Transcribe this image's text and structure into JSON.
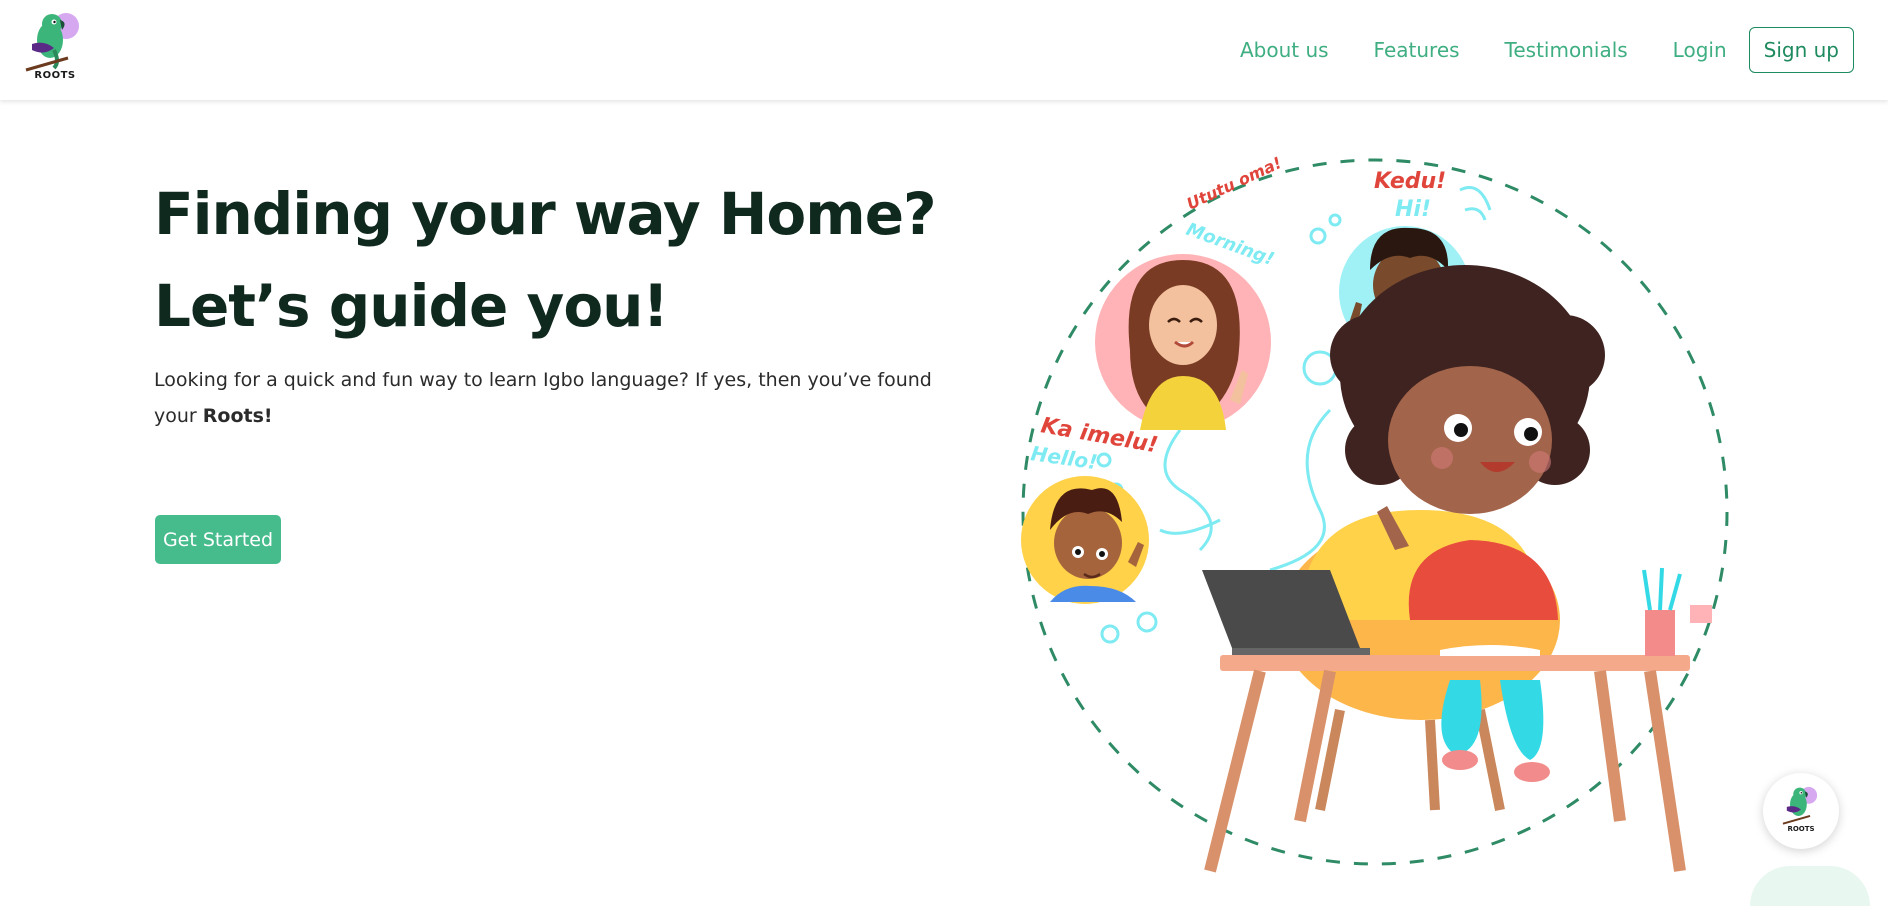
{
  "brand": {
    "name": "ROOTS"
  },
  "nav": {
    "links": [
      "About us",
      "Features",
      "Testimonials",
      "Login"
    ],
    "signup_label": "Sign up"
  },
  "hero": {
    "title_line1": "Finding your way Home?",
    "title_line2": "Let’s guide you!",
    "desc_text": "Looking for a quick and fun way to learn Igbo language? If yes, then you’ve found your",
    "desc_bold": "Roots!",
    "cta_label": "Get Started"
  },
  "illustration": {
    "greetings": [
      "Kedu!",
      "Hi!",
      "Ka imelu!",
      "Hello!",
      "Ututu oma!",
      "Morning!"
    ]
  },
  "floating_widget": {
    "label": "ROOTS"
  },
  "colors": {
    "primary": "#46bb8c",
    "primary_dark": "#1e8a5f",
    "heading": "#10291f"
  }
}
